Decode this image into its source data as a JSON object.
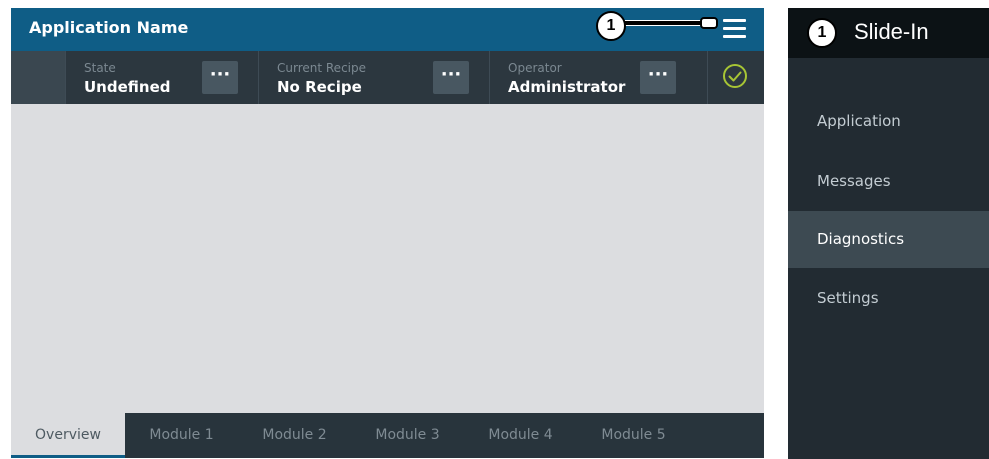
{
  "app": {
    "title": "Application Name",
    "status": [
      {
        "label": "State",
        "value": "Undefined",
        "button": "···"
      },
      {
        "label": "Current Recipe",
        "value": "No Recipe",
        "button": "···"
      },
      {
        "label": "Operator",
        "value": "Administrator",
        "button": "···"
      }
    ],
    "tabs": [
      "Overview",
      "Module 1",
      "Module 2",
      "Module 3",
      "Module 4",
      "Module 5"
    ],
    "active_tab": "Overview",
    "callout_number": "1"
  },
  "panel": {
    "badge": "1",
    "title": "Slide-In",
    "items": [
      "Application",
      "Messages",
      "Diagnostics",
      "Settings"
    ],
    "active_item": "Diagnostics"
  },
  "colors": {
    "title_bar": "#0f5d86",
    "status_bar": "#2c373f",
    "content": "#dcdde0",
    "tab_bar": "#28343c",
    "panel": "#222b32",
    "panel_active": "#3d4a52",
    "ok_check": "#a7c535"
  },
  "icons": {
    "menu": "hamburger-menu-icon",
    "status_ok": "check-circle-icon",
    "more": "ellipsis-icon"
  }
}
